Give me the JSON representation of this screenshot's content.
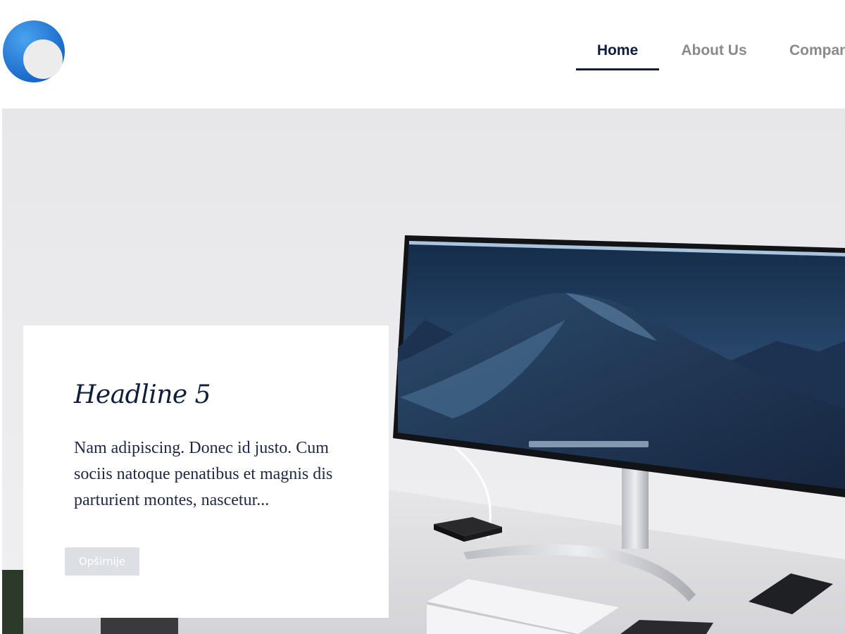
{
  "header": {
    "logo_name": "circle-logo",
    "nav": [
      {
        "label": "Home",
        "active": true
      },
      {
        "label": "About Us",
        "active": false
      },
      {
        "label": "Company",
        "active": false
      }
    ]
  },
  "hero": {
    "card": {
      "headline": "Headline 5",
      "body": "Nam adipiscing. Donec id justo. Cum sociis natoque penatibus et magnis dis parturient montes, nascetur...",
      "button_label": "Opširnije"
    }
  },
  "colors": {
    "nav_active": "#0f1e3c",
    "nav_inactive": "#8a8a8a",
    "logo_blue": "#1f78d6",
    "button_bg": "#dcdfe3"
  }
}
